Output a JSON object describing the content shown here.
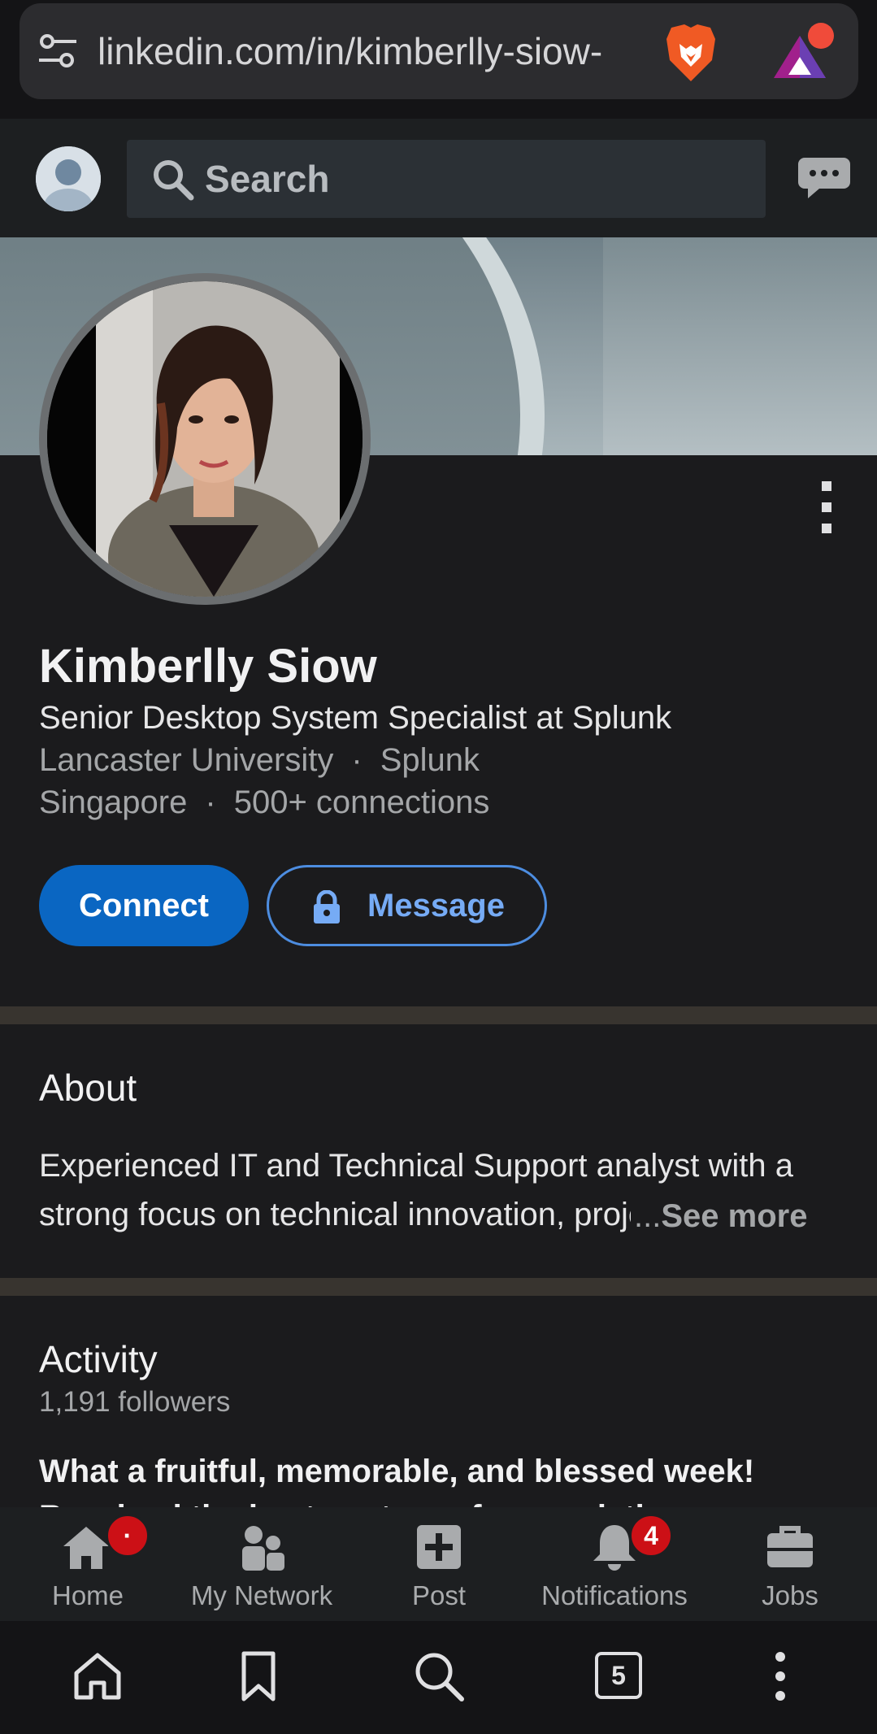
{
  "browser": {
    "url": "linkedin.com/in/kimberlly-siow-",
    "tabs_count": "5"
  },
  "header": {
    "search_placeholder": "Search"
  },
  "profile": {
    "name": "Kimberlly Siow",
    "headline": "Senior Desktop System Specialist at Splunk",
    "education": "Lancaster University",
    "company": "Splunk",
    "location": "Singapore",
    "connections": "500+ connections",
    "separator": "·"
  },
  "actions": {
    "connect_label": "Connect",
    "message_label": "Message"
  },
  "about": {
    "title": "About",
    "line1": "Experienced IT and Technical Support analyst with a",
    "line2": "strong focus on technical innovation, proje",
    "ellipsis": "...",
    "see_more": "See more"
  },
  "activity": {
    "title": "Activity",
    "followers": "1,191 followers",
    "post_title": "What a fruitful, memorable, and blessed week!",
    "post_next_line": "Received the best gesture of appreciation"
  },
  "nav": {
    "items": [
      {
        "label": "Home",
        "badge": "·"
      },
      {
        "label": "My Network"
      },
      {
        "label": "Post"
      },
      {
        "label": "Notifications",
        "badge": "4"
      },
      {
        "label": "Jobs"
      }
    ]
  },
  "colors": {
    "accent": "#0a66c2",
    "badge": "#cc1016",
    "background": "#1b1b1d"
  }
}
